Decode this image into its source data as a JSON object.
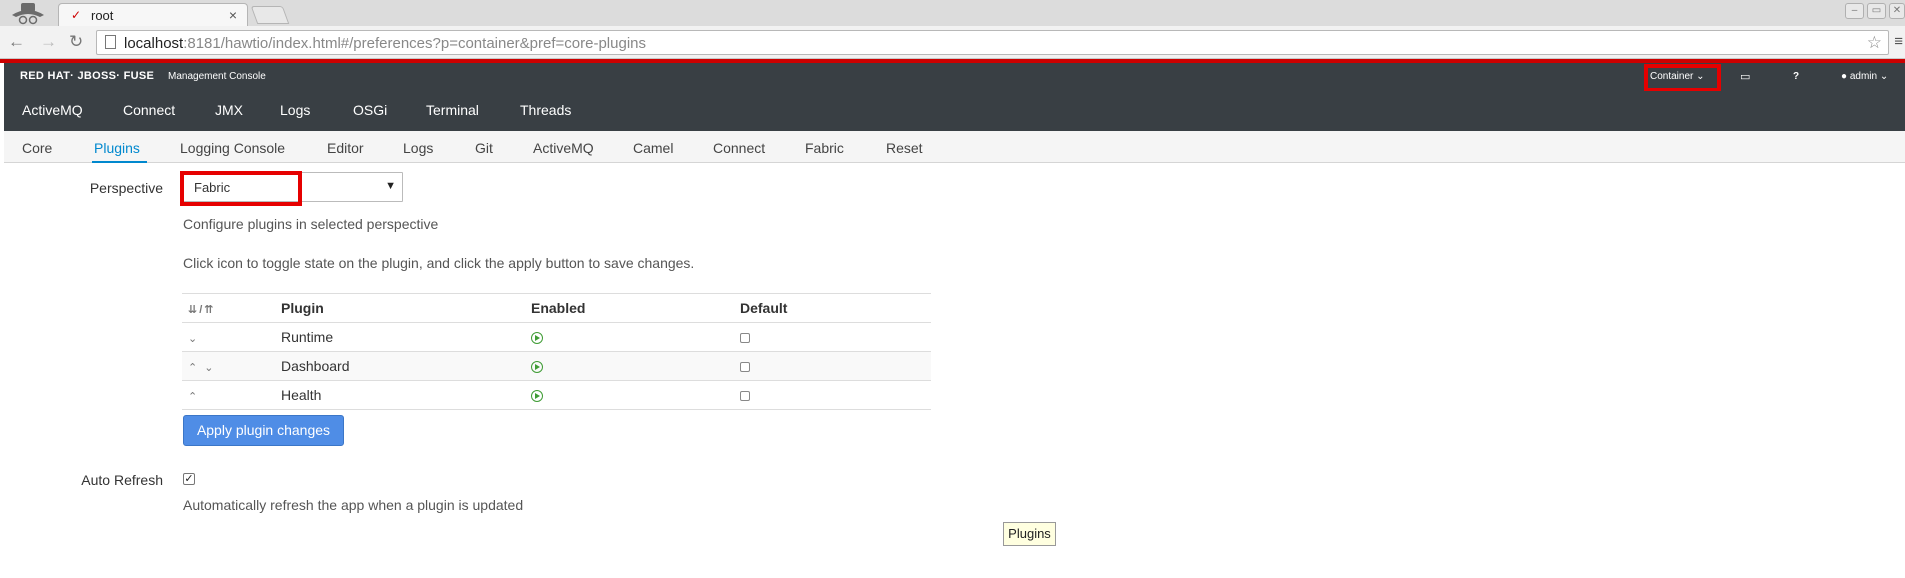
{
  "browser": {
    "tab_title": "root",
    "tab_close": "×",
    "url_host": "localhost",
    "url_rest": ":8181/hawtio/index.html#/preferences?p=container&pref=core-plugins"
  },
  "header": {
    "brand": "RED HAT· JBOSS· FUSE",
    "subtitle": "Management Console",
    "container_label": "Container",
    "user_label": "admin"
  },
  "main_nav": [
    "ActiveMQ",
    "Connect",
    "JMX",
    "Logs",
    "OSGi",
    "Terminal",
    "Threads"
  ],
  "sub_nav": [
    "Core",
    "Plugins",
    "Logging Console",
    "Editor",
    "Logs",
    "Git",
    "ActiveMQ",
    "Camel",
    "Connect",
    "Fabric",
    "Reset"
  ],
  "sub_nav_active": "Plugins",
  "perspective": {
    "label": "Perspective",
    "selected": "Fabric",
    "description": "Configure plugins in selected perspective",
    "instructions": "Click icon to toggle state on the plugin, and click the apply button to save changes."
  },
  "table": {
    "headers": [
      "Plugin",
      "Enabled",
      "Default"
    ],
    "rows": [
      {
        "name": "Runtime",
        "enabled": true,
        "default": false
      },
      {
        "name": "Dashboard",
        "enabled": true,
        "default": false
      },
      {
        "name": "Health",
        "enabled": true,
        "default": false
      }
    ]
  },
  "apply_button": "Apply plugin changes",
  "auto_refresh": {
    "label": "Auto Refresh",
    "checked": true,
    "description": "Automatically refresh the app when a plugin is updated"
  },
  "tooltip": "Plugins",
  "colors": {
    "accent_red": "#cc0000",
    "header_bg": "#393f44",
    "link_blue": "#0088ce",
    "button_blue": "#4f8de6",
    "enabled_green": "#3f9c35",
    "highlight_red": "#e60000"
  }
}
